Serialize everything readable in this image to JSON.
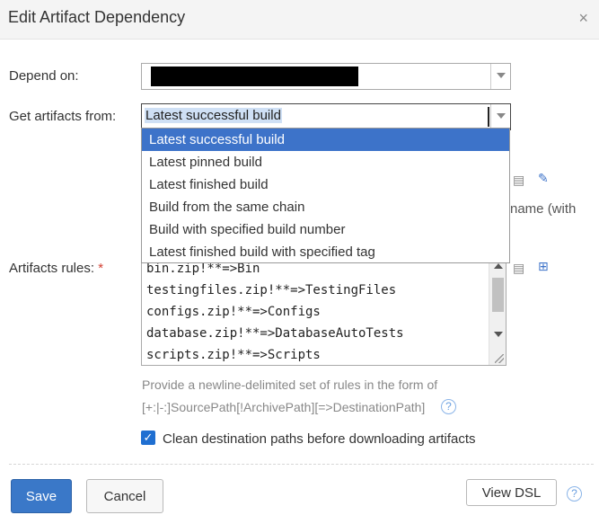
{
  "dialog": {
    "title": "Edit Artifact Dependency",
    "close_icon": "close-icon"
  },
  "depend_on": {
    "label": "Depend on:",
    "value_redacted": true
  },
  "get_artifacts": {
    "label": "Get artifacts from:",
    "selected": "Latest successful build",
    "options": [
      "Latest successful build",
      "Latest pinned build",
      "Latest finished build",
      "Build from the same chain",
      "Build with specified build number",
      "Latest finished build with specified tag"
    ]
  },
  "hidden_text": {
    "name_with": "name (with"
  },
  "artifacts_rules": {
    "label": "Artifacts rules:",
    "required_mark": "*",
    "lines": [
      "bin.zip!**=>Bin",
      "testingfiles.zip!**=>TestingFiles",
      "configs.zip!**=>Configs",
      "database.zip!**=>DatabaseAutoTests",
      "scripts.zip!**=>Scripts"
    ],
    "help_line1": "Provide a newline-delimited set of rules in the form of",
    "help_line2": "[+:|-:]SourcePath[!ArchivePath][=>DestinationPath]"
  },
  "clean_destination": {
    "checked": true,
    "label": "Clean destination paths before downloading artifacts"
  },
  "footer": {
    "save_label": "Save",
    "cancel_label": "Cancel",
    "view_dsl_label": "View DSL"
  },
  "colors": {
    "save_bg": "#3a78c8",
    "dropdown_highlight": "#3d73c9",
    "required": "#d23f31"
  }
}
